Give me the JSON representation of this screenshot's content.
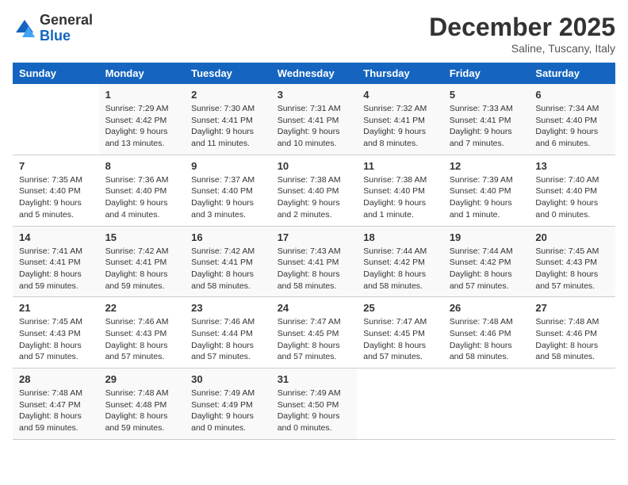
{
  "logo": {
    "general": "General",
    "blue": "Blue"
  },
  "title": "December 2025",
  "subtitle": "Saline, Tuscany, Italy",
  "days_header": [
    "Sunday",
    "Monday",
    "Tuesday",
    "Wednesday",
    "Thursday",
    "Friday",
    "Saturday"
  ],
  "weeks": [
    [
      {
        "day": "",
        "info": ""
      },
      {
        "day": "1",
        "info": "Sunrise: 7:29 AM\nSunset: 4:42 PM\nDaylight: 9 hours\nand 13 minutes."
      },
      {
        "day": "2",
        "info": "Sunrise: 7:30 AM\nSunset: 4:41 PM\nDaylight: 9 hours\nand 11 minutes."
      },
      {
        "day": "3",
        "info": "Sunrise: 7:31 AM\nSunset: 4:41 PM\nDaylight: 9 hours\nand 10 minutes."
      },
      {
        "day": "4",
        "info": "Sunrise: 7:32 AM\nSunset: 4:41 PM\nDaylight: 9 hours\nand 8 minutes."
      },
      {
        "day": "5",
        "info": "Sunrise: 7:33 AM\nSunset: 4:41 PM\nDaylight: 9 hours\nand 7 minutes."
      },
      {
        "day": "6",
        "info": "Sunrise: 7:34 AM\nSunset: 4:40 PM\nDaylight: 9 hours\nand 6 minutes."
      }
    ],
    [
      {
        "day": "7",
        "info": "Sunrise: 7:35 AM\nSunset: 4:40 PM\nDaylight: 9 hours\nand 5 minutes."
      },
      {
        "day": "8",
        "info": "Sunrise: 7:36 AM\nSunset: 4:40 PM\nDaylight: 9 hours\nand 4 minutes."
      },
      {
        "day": "9",
        "info": "Sunrise: 7:37 AM\nSunset: 4:40 PM\nDaylight: 9 hours\nand 3 minutes."
      },
      {
        "day": "10",
        "info": "Sunrise: 7:38 AM\nSunset: 4:40 PM\nDaylight: 9 hours\nand 2 minutes."
      },
      {
        "day": "11",
        "info": "Sunrise: 7:38 AM\nSunset: 4:40 PM\nDaylight: 9 hours\nand 1 minute."
      },
      {
        "day": "12",
        "info": "Sunrise: 7:39 AM\nSunset: 4:40 PM\nDaylight: 9 hours\nand 1 minute."
      },
      {
        "day": "13",
        "info": "Sunrise: 7:40 AM\nSunset: 4:40 PM\nDaylight: 9 hours\nand 0 minutes."
      }
    ],
    [
      {
        "day": "14",
        "info": "Sunrise: 7:41 AM\nSunset: 4:41 PM\nDaylight: 8 hours\nand 59 minutes."
      },
      {
        "day": "15",
        "info": "Sunrise: 7:42 AM\nSunset: 4:41 PM\nDaylight: 8 hours\nand 59 minutes."
      },
      {
        "day": "16",
        "info": "Sunrise: 7:42 AM\nSunset: 4:41 PM\nDaylight: 8 hours\nand 58 minutes."
      },
      {
        "day": "17",
        "info": "Sunrise: 7:43 AM\nSunset: 4:41 PM\nDaylight: 8 hours\nand 58 minutes."
      },
      {
        "day": "18",
        "info": "Sunrise: 7:44 AM\nSunset: 4:42 PM\nDaylight: 8 hours\nand 58 minutes."
      },
      {
        "day": "19",
        "info": "Sunrise: 7:44 AM\nSunset: 4:42 PM\nDaylight: 8 hours\nand 57 minutes."
      },
      {
        "day": "20",
        "info": "Sunrise: 7:45 AM\nSunset: 4:43 PM\nDaylight: 8 hours\nand 57 minutes."
      }
    ],
    [
      {
        "day": "21",
        "info": "Sunrise: 7:45 AM\nSunset: 4:43 PM\nDaylight: 8 hours\nand 57 minutes."
      },
      {
        "day": "22",
        "info": "Sunrise: 7:46 AM\nSunset: 4:43 PM\nDaylight: 8 hours\nand 57 minutes."
      },
      {
        "day": "23",
        "info": "Sunrise: 7:46 AM\nSunset: 4:44 PM\nDaylight: 8 hours\nand 57 minutes."
      },
      {
        "day": "24",
        "info": "Sunrise: 7:47 AM\nSunset: 4:45 PM\nDaylight: 8 hours\nand 57 minutes."
      },
      {
        "day": "25",
        "info": "Sunrise: 7:47 AM\nSunset: 4:45 PM\nDaylight: 8 hours\nand 57 minutes."
      },
      {
        "day": "26",
        "info": "Sunrise: 7:48 AM\nSunset: 4:46 PM\nDaylight: 8 hours\nand 58 minutes."
      },
      {
        "day": "27",
        "info": "Sunrise: 7:48 AM\nSunset: 4:46 PM\nDaylight: 8 hours\nand 58 minutes."
      }
    ],
    [
      {
        "day": "28",
        "info": "Sunrise: 7:48 AM\nSunset: 4:47 PM\nDaylight: 8 hours\nand 59 minutes."
      },
      {
        "day": "29",
        "info": "Sunrise: 7:48 AM\nSunset: 4:48 PM\nDaylight: 8 hours\nand 59 minutes."
      },
      {
        "day": "30",
        "info": "Sunrise: 7:49 AM\nSunset: 4:49 PM\nDaylight: 9 hours\nand 0 minutes."
      },
      {
        "day": "31",
        "info": "Sunrise: 7:49 AM\nSunset: 4:50 PM\nDaylight: 9 hours\nand 0 minutes."
      },
      {
        "day": "",
        "info": ""
      },
      {
        "day": "",
        "info": ""
      },
      {
        "day": "",
        "info": ""
      }
    ]
  ]
}
